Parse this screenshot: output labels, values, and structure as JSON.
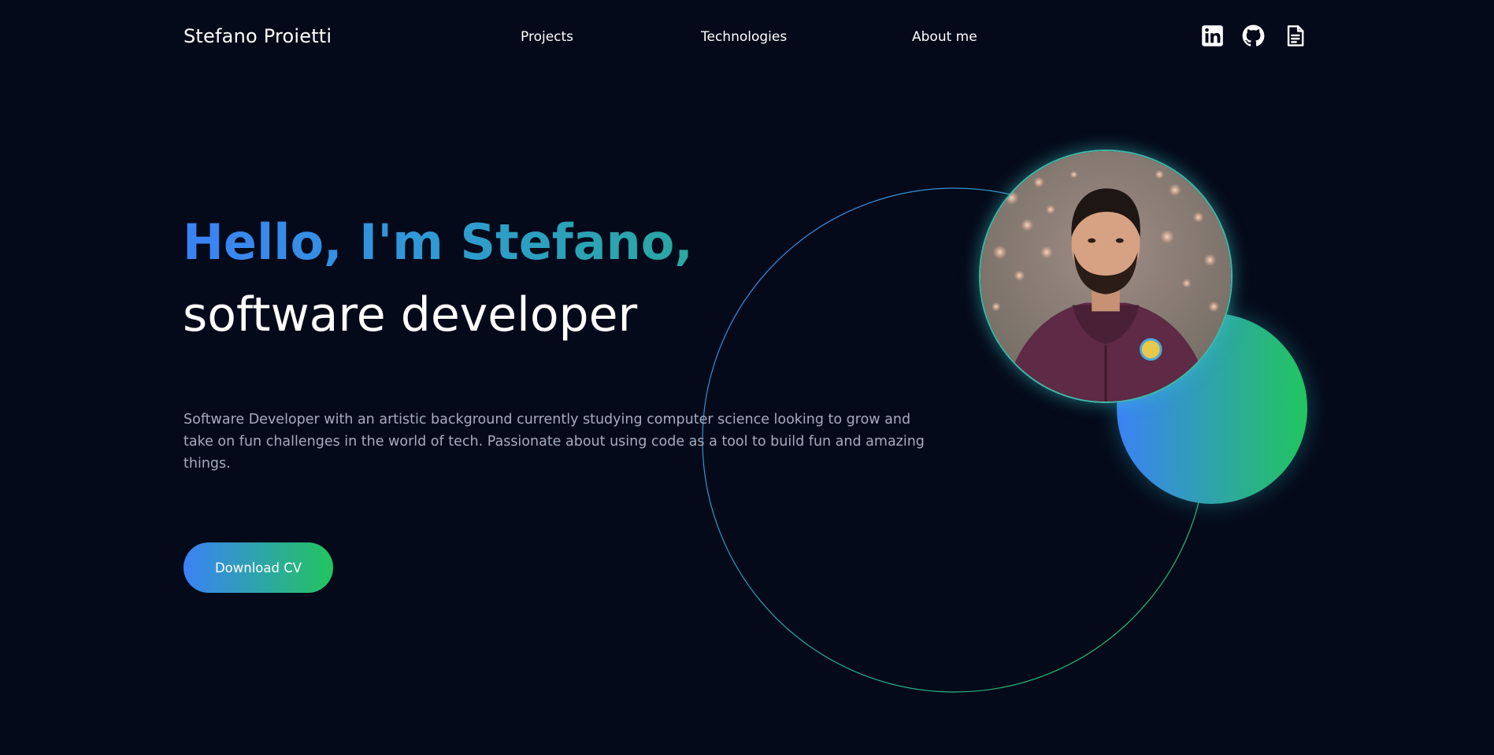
{
  "header": {
    "brand": "Stefano Proietti",
    "nav": [
      {
        "label": "Projects"
      },
      {
        "label": "Technologies"
      },
      {
        "label": "About me"
      }
    ],
    "social_icons": [
      "linkedin-icon",
      "github-icon",
      "document-icon"
    ]
  },
  "hero": {
    "greeting": "Hello, I'm Stefano,",
    "role": "software developer",
    "description": "Software Developer with an artistic background currently studying computer science looking to grow and take on fun challenges in the world of tech. Passionate about using code as a tool to build fun and amazing things.",
    "cta_label": "Download CV"
  },
  "colors": {
    "background": "#050a1a",
    "accent_blue": "#3b82f6",
    "accent_green": "#22c55e",
    "body_text": "#a3adbf"
  }
}
